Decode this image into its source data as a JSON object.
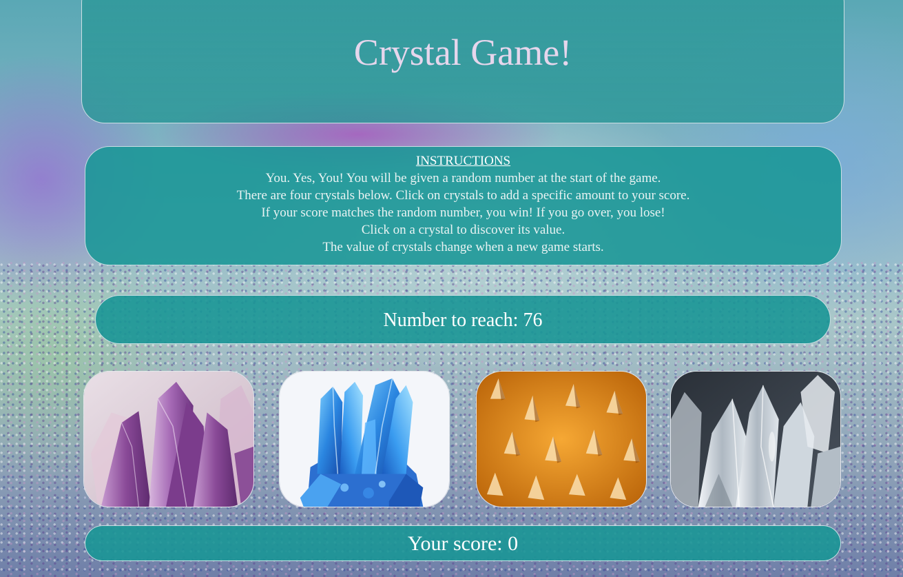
{
  "title": "Crystal Game!",
  "instructions": {
    "heading": "INSTRUCTIONS",
    "lines": [
      "You. Yes, You! You will be given a random number at the start of the game.",
      "There are four crystals below. Click on crystals to add a specific amount to your score.",
      "If your score matches the random number, you win! If you go over, you lose!",
      "Click on a crystal to discover its value.",
      "The value of crystals change when a new game starts."
    ]
  },
  "target": {
    "label": "Number to reach: 76",
    "value": 76
  },
  "score": {
    "label": "Your score: 0",
    "value": 0
  },
  "crystals": [
    {
      "icon": "purple-amethyst-crystal-icon",
      "color": "#9a5aa8"
    },
    {
      "icon": "blue-crystal-cluster-icon",
      "color": "#2f86e0"
    },
    {
      "icon": "orange-citrine-crystal-icon",
      "color": "#e08a1a"
    },
    {
      "icon": "clear-quartz-crystal-icon",
      "color": "#b8c2cc"
    }
  ],
  "colors": {
    "panel": "#199696",
    "title_text": "#e6d6ec",
    "panel_border": "#e6ebf0"
  }
}
